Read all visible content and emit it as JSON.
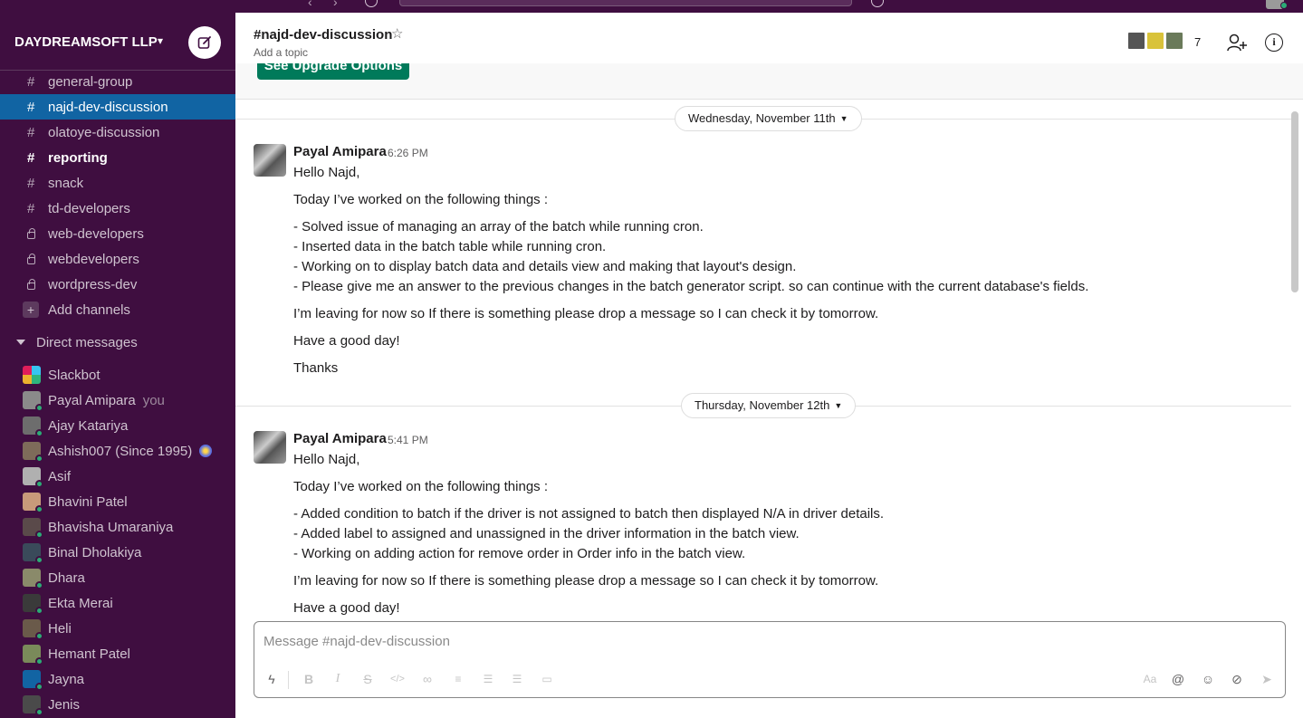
{
  "workspace": {
    "name": "DAYDREAMSOFT LLP",
    "caret": "⌄"
  },
  "sidebar": {
    "channels": [
      {
        "name": "general-group",
        "kind": "public",
        "state": "normal"
      },
      {
        "name": "najd-dev-discussion",
        "kind": "public",
        "state": "active"
      },
      {
        "name": "olatoye-discussion",
        "kind": "public",
        "state": "normal"
      },
      {
        "name": "reporting",
        "kind": "public",
        "state": "unread"
      },
      {
        "name": "snack",
        "kind": "public",
        "state": "normal"
      },
      {
        "name": "td-developers",
        "kind": "public",
        "state": "normal"
      },
      {
        "name": "web-developers",
        "kind": "private",
        "state": "normal"
      },
      {
        "name": "webdevelopers",
        "kind": "private",
        "state": "normal"
      },
      {
        "name": "wordpress-dev",
        "kind": "private",
        "state": "normal"
      }
    ],
    "add_channels": "Add channels",
    "dm_header": "Direct messages",
    "direct_messages": [
      {
        "name": "Slackbot",
        "you": "",
        "online": false,
        "color": "#ecb22e"
      },
      {
        "name": "Payal Amipara",
        "you": "you",
        "online": true,
        "color": "#8a8a8a"
      },
      {
        "name": "Ajay Katariya",
        "you": "",
        "online": true,
        "color": "#6d6d6d"
      },
      {
        "name": "Ashish007 (Since 1995)",
        "you": "",
        "online": true,
        "color": "#7e6b5a",
        "badge": true
      },
      {
        "name": "Asif",
        "you": "",
        "online": true,
        "color": "#b0b0b0"
      },
      {
        "name": "Bhavini Patel",
        "you": "",
        "online": true,
        "color": "#c89a7a"
      },
      {
        "name": "Bhavisha Umaraniya",
        "you": "",
        "online": true,
        "color": "#5a4a4a"
      },
      {
        "name": "Binal Dholakiya",
        "you": "",
        "online": true,
        "color": "#3a4a5a"
      },
      {
        "name": "Dhara",
        "you": "",
        "online": true,
        "color": "#8a8a6a"
      },
      {
        "name": "Ekta Merai",
        "you": "",
        "online": true,
        "color": "#3a3a3a"
      },
      {
        "name": "Heli",
        "you": "",
        "online": true,
        "color": "#6a5a4a"
      },
      {
        "name": "Hemant Patel",
        "you": "",
        "online": true,
        "color": "#7a8a5a"
      },
      {
        "name": "Jayna",
        "you": "",
        "online": true,
        "color": "#1264a3"
      },
      {
        "name": "Jenis",
        "you": "",
        "online": true,
        "color": "#4a4a4a"
      }
    ]
  },
  "header": {
    "channel_title": "#najd-dev-discussion",
    "topic": "Add a topic",
    "member_count": "7",
    "member_colors": [
      "#555555",
      "#d9c33a",
      "#6a7a5a"
    ]
  },
  "banner": {
    "button": "See Upgrade Options"
  },
  "messages": [
    {
      "day": "Wednesday, November 11th",
      "author": "Payal Amipara",
      "time": "6:26 PM",
      "greeting": "Hello Najd,",
      "intro": "Today I’ve worked on the following things :",
      "items": [
        "- Solved issue of managing an array of the batch while running cron.",
        "- Inserted data in the batch table while running cron.",
        "- Working on to display batch data and details view and making that layout's design.",
        "- Please give me an answer to the previous changes in the batch generator script. so can continue with the current database's fields."
      ],
      "leaving": "I’m leaving for now so If there is something please drop a message so I can check it by tomorrow.",
      "wish": "Have a good day!",
      "closing": "Thanks"
    },
    {
      "day": "Thursday, November 12th",
      "author": "Payal Amipara",
      "time": "5:41 PM",
      "greeting": "Hello Najd,",
      "intro": "Today I’ve worked on the following things :",
      "items": [
        "- Added condition to batch if the driver is not assigned to batch then displayed N/A in driver details.",
        "- Added label to assigned and unassigned in the driver information in the batch view.",
        "- Working on adding action for remove order in Order info in the batch view."
      ],
      "leaving": "I’m leaving for now so If there is something please drop a message so I can check it by tomorrow.",
      "wish": "Have a good day!",
      "closing": ""
    }
  ],
  "composer": {
    "placeholder": "Message #najd-dev-discussion",
    "tools": [
      "lightning-icon",
      "bold-icon",
      "italic-icon",
      "strikethrough-icon",
      "code-icon",
      "link-icon",
      "ordered-list-icon",
      "bulleted-list-icon",
      "blockquote-icon",
      "code-block-icon"
    ],
    "right_tools": [
      "format-toggle-icon",
      "mention-icon",
      "emoji-icon",
      "attachment-icon",
      "send-icon"
    ]
  }
}
